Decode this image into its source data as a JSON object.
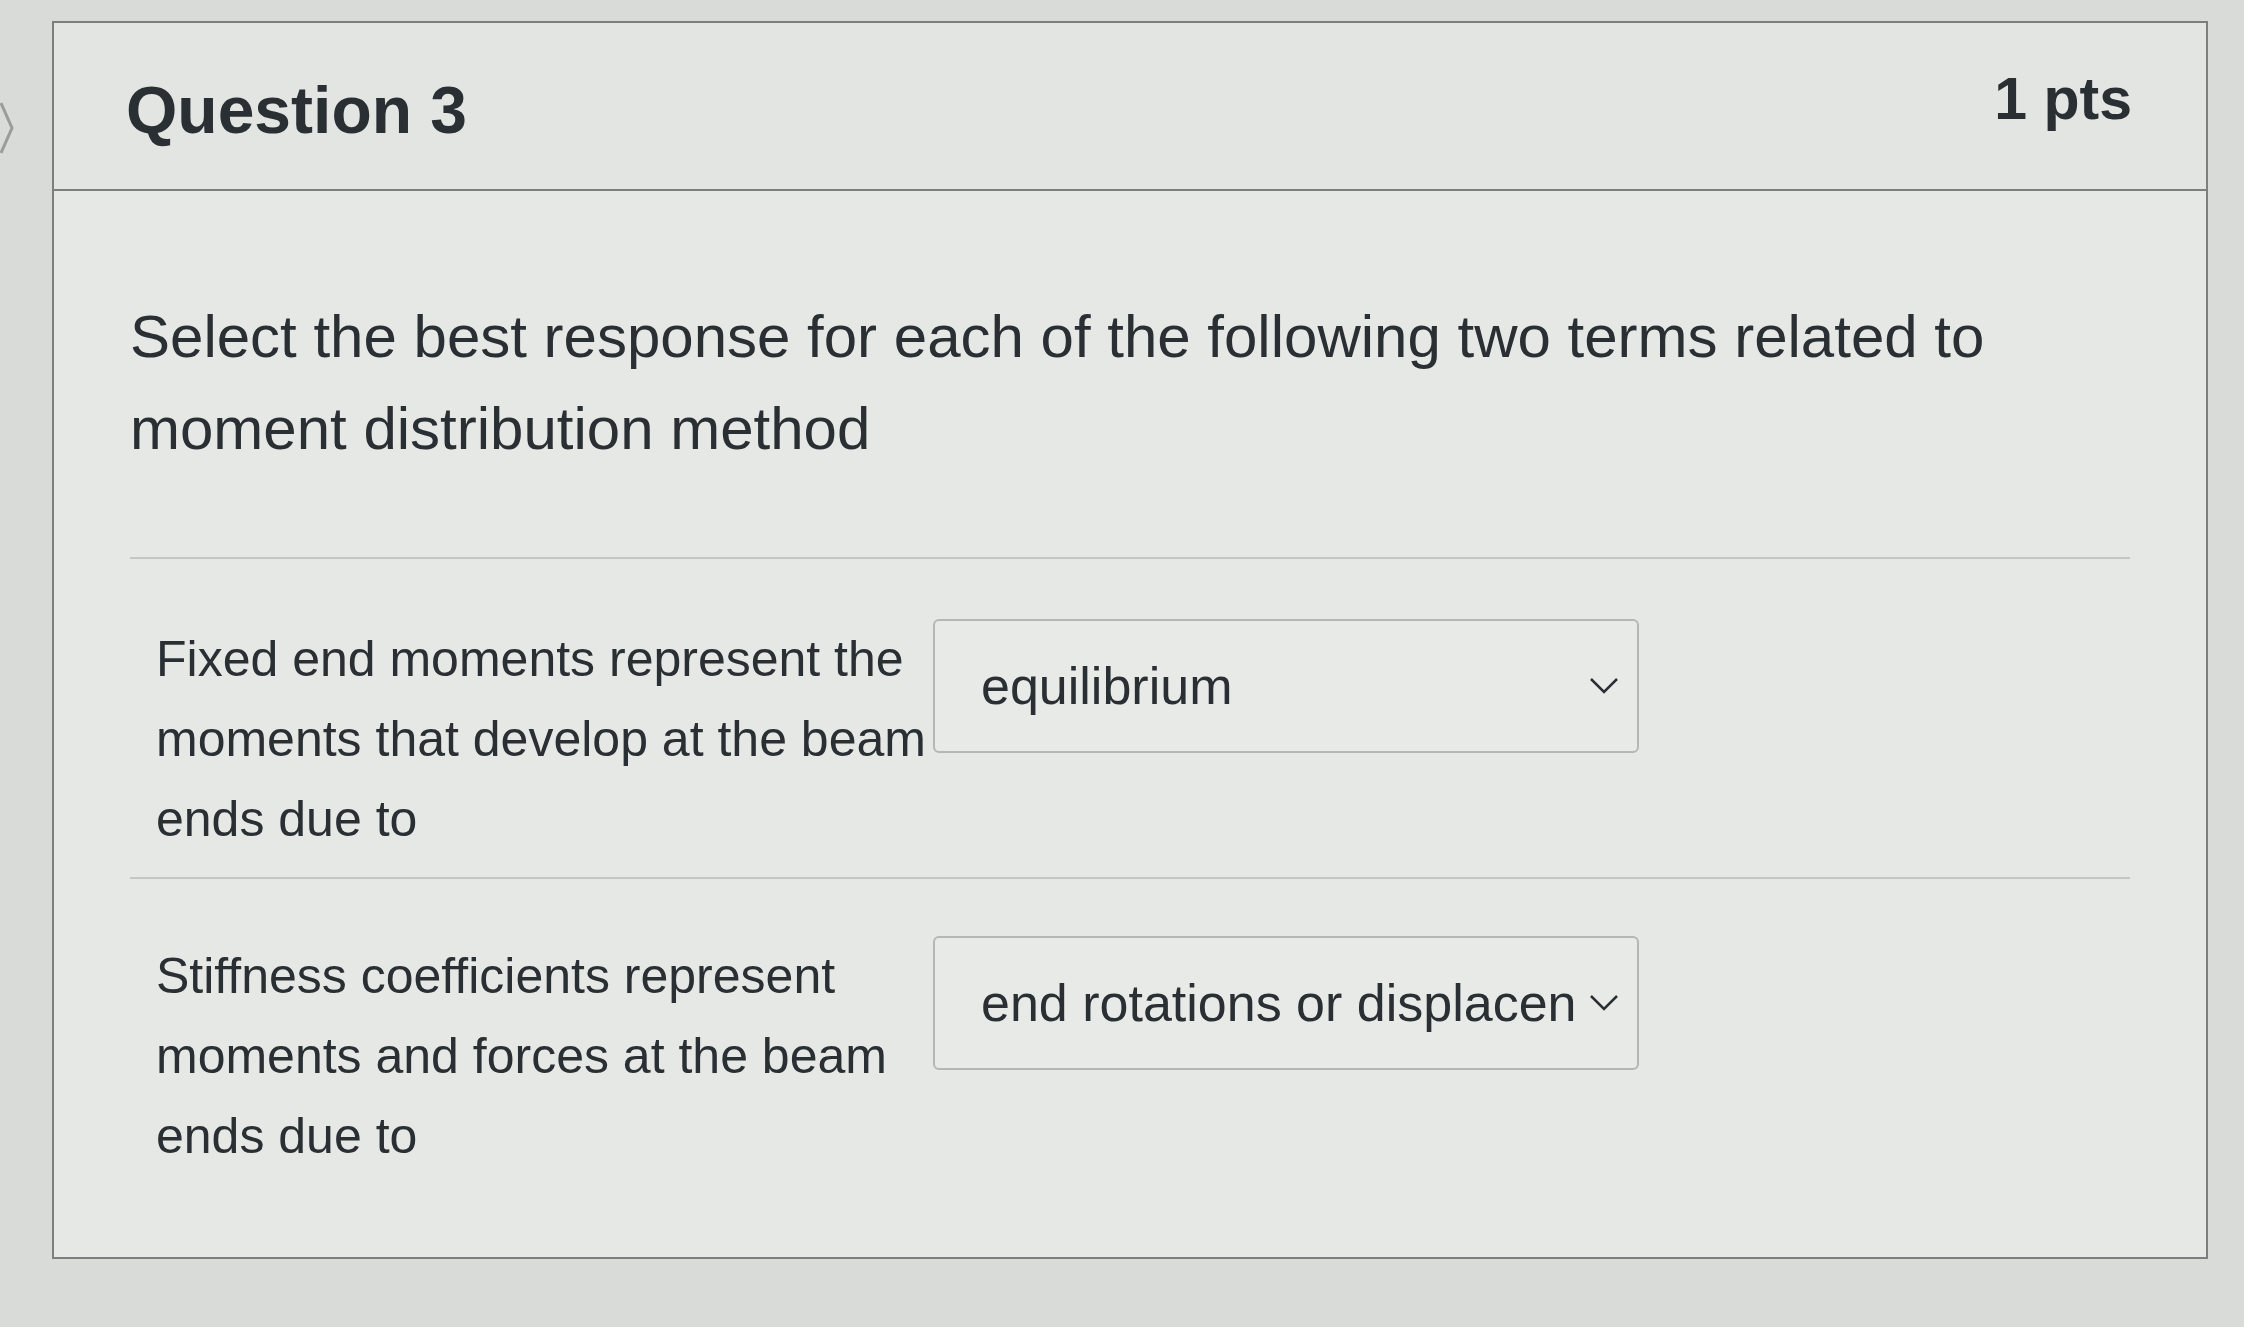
{
  "question": {
    "title": "Question 3",
    "points": "1 pts",
    "text": "Select the best response for each of the following two terms related to moment distribution method"
  },
  "matches": [
    {
      "prompt": "Fixed end moments represent the moments that develop at the beam ends due to",
      "answer": "equilibrium"
    },
    {
      "prompt": "Stiffness coefficients represent moments and forces at the beam ends due to",
      "answer": "end rotations or displacen"
    }
  ]
}
